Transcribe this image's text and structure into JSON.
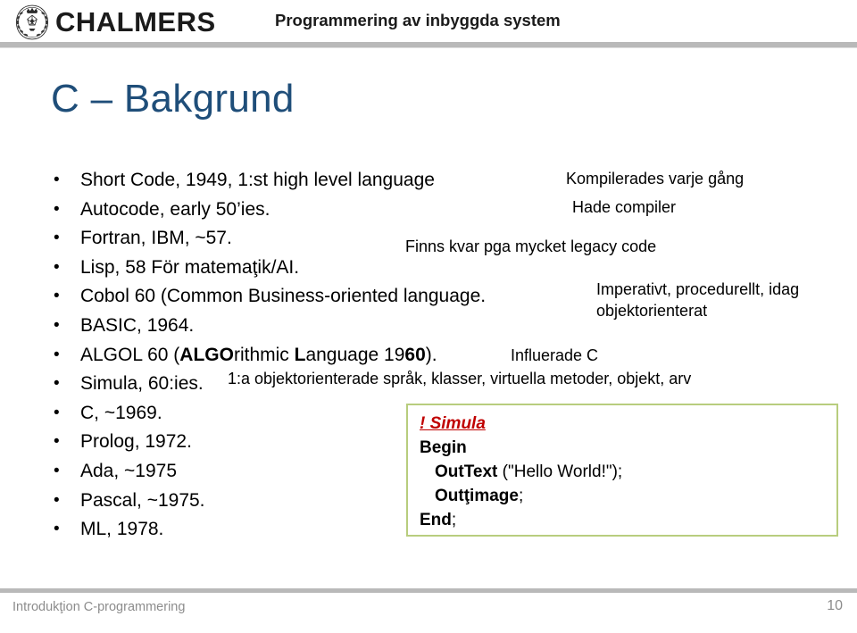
{
  "header": {
    "logo_icon": "chalmers-seal-icon",
    "wordmark": "CHALMERS",
    "course_title": "Programmering av inbyggda system"
  },
  "slide": {
    "title": "C – Bakgrund",
    "bullets": [
      {
        "text": "Short Code, 1949, 1:st high level language"
      },
      {
        "text": "Autocode, early 50’ies."
      },
      {
        "text": "Fortran, IBM, ~57."
      },
      {
        "text": "Lisp, 58        För matemaţik/AI."
      },
      {
        "text": "Cobol 60 (Common Business-oriented language."
      },
      {
        "text": "BASIC, 1964."
      },
      {
        "html": "ALGOL 60 (<b>ALGO</b>rithmic <b>L</b>anguage 19<b>60</b>)."
      },
      {
        "text": "Simula, 60:ies."
      },
      {
        "text": "C, ~1969."
      },
      {
        "text": "Prolog, 1972."
      },
      {
        "text": "Ada, ~1975"
      },
      {
        "text": "Pascal, ~1975."
      },
      {
        "text": "ML, 1978."
      }
    ],
    "annotations": {
      "kompilerades": "Kompilerades varje gång",
      "hade_compiler": "Hade compiler",
      "finns_kvar": "Finns kvar pga mycket legacy code",
      "imperativt": "Imperativt, procedurellt, idag objektorienterat",
      "influerade": "Influerade C",
      "simula_note": "1:a objektorienterade språk, klasser, virtuella metoder, objekt, arv"
    },
    "code_box": {
      "border_color": "#b8cd7e",
      "comment_color": "#c00000",
      "lines": {
        "comment": "! Simula ",
        "begin": "Begin",
        "outtext_kw": "OutText",
        "outtext_rest": " (\"Hello World!\");",
        "outimage_kw": "Outţimage",
        "outimage_rest": ";",
        "end_kw": "End",
        "end_rest": ";"
      }
    }
  },
  "footer": {
    "left": "Introdukţion C-programmering",
    "page": "10"
  },
  "colors": {
    "title_blue": "#1f4e79",
    "rule_gray": "#b9b9b9",
    "footer_gray": "#8c8c8c",
    "code_border": "#b8cd7e",
    "comment_red": "#c00000"
  }
}
